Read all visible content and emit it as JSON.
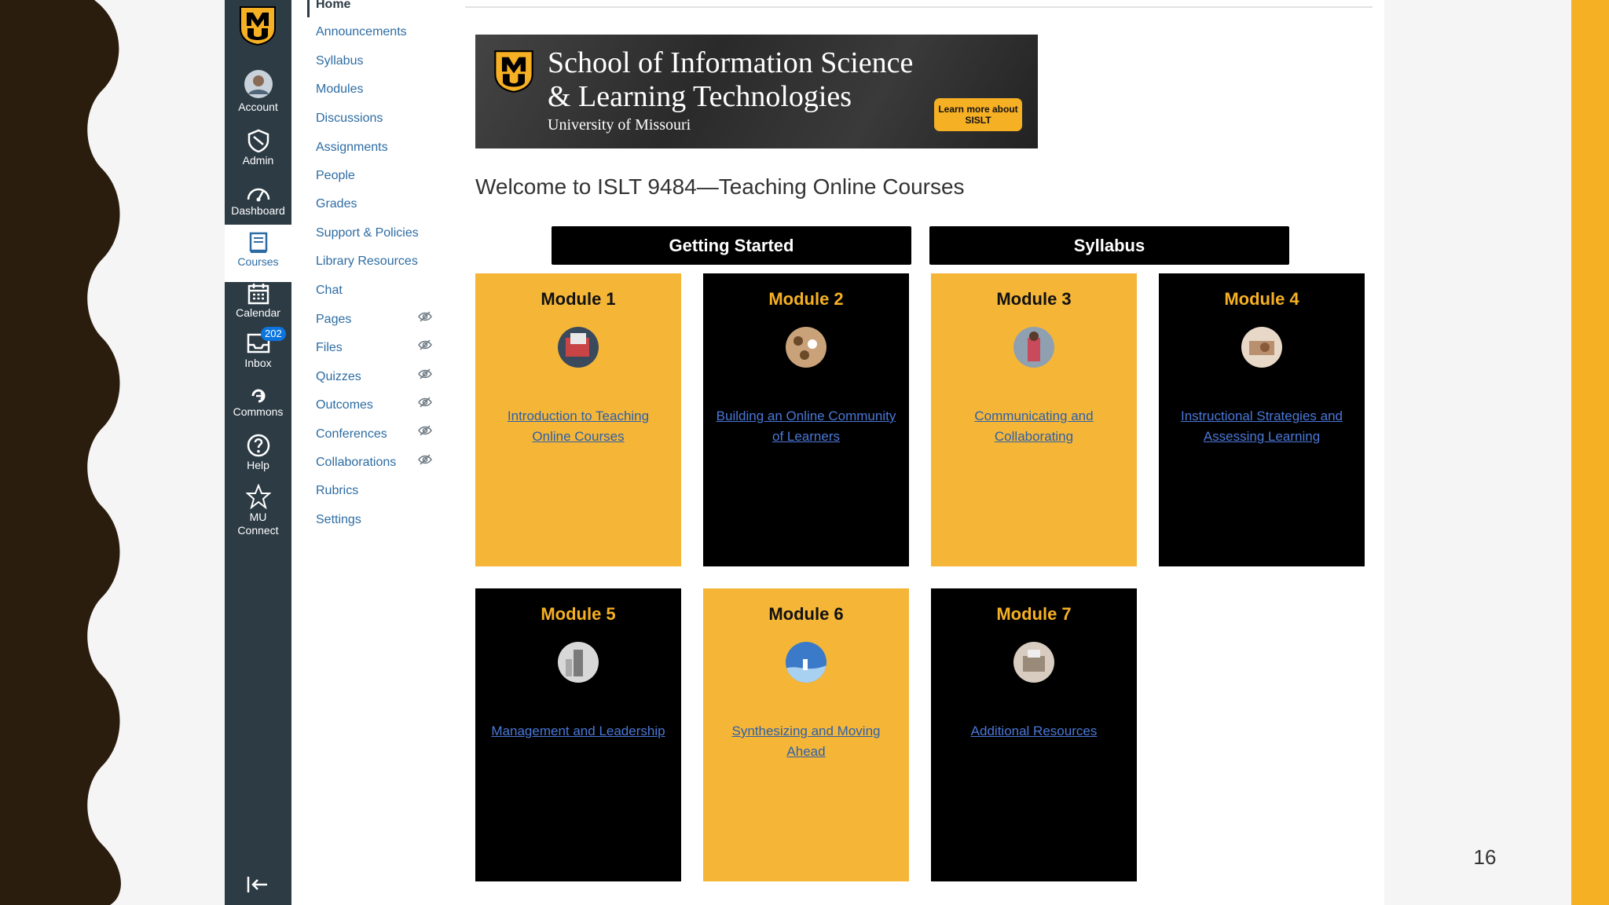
{
  "slide": {
    "page_number": "16"
  },
  "global_nav": {
    "items": [
      {
        "label": "Account",
        "icon": "avatar-icon"
      },
      {
        "label": "Admin",
        "icon": "shield-icon"
      },
      {
        "label": "Dashboard",
        "icon": "dashboard-icon"
      },
      {
        "label": "Courses",
        "icon": "courses-icon",
        "active": true
      },
      {
        "label": "Calendar",
        "icon": "calendar-icon"
      },
      {
        "label": "Inbox",
        "icon": "inbox-icon",
        "badge": "202"
      },
      {
        "label": "Commons",
        "icon": "commons-icon"
      },
      {
        "label": "Help",
        "icon": "help-icon"
      },
      {
        "label": "MU",
        "label2": "Connect",
        "icon": "star-icon"
      }
    ]
  },
  "course_nav": {
    "items": [
      {
        "label": "Home"
      },
      {
        "label": "Announcements"
      },
      {
        "label": "Syllabus"
      },
      {
        "label": "Modules"
      },
      {
        "label": "Discussions"
      },
      {
        "label": "Assignments"
      },
      {
        "label": "People"
      },
      {
        "label": "Grades"
      },
      {
        "label": "Support & Policies"
      },
      {
        "label": "Library Resources"
      },
      {
        "label": "Chat"
      },
      {
        "label": "Pages",
        "hidden": true
      },
      {
        "label": "Files",
        "hidden": true
      },
      {
        "label": "Quizzes",
        "hidden": true
      },
      {
        "label": "Outcomes",
        "hidden": true
      },
      {
        "label": "Conferences",
        "hidden": true
      },
      {
        "label": "Collaborations",
        "hidden": true
      },
      {
        "label": "Rubrics"
      },
      {
        "label": "Settings"
      }
    ]
  },
  "banner": {
    "title_line1": "School of Information Science",
    "title_line2": "& Learning Technologies",
    "subtitle": "University of Missouri",
    "button": "Learn more about SISLT"
  },
  "welcome": "Welcome to ISLT 9484—Teaching Online Courses",
  "buttons": {
    "getting_started": "Getting Started",
    "syllabus": "Syllabus"
  },
  "modules": [
    {
      "title": "Module 1",
      "link": "Introduction to Teaching Online Courses",
      "theme": "gold"
    },
    {
      "title": "Module 2",
      "link": "Building an Online Community of Learners",
      "theme": "black"
    },
    {
      "title": "Module 3",
      "link": "Communicating and Collaborating",
      "theme": "gold"
    },
    {
      "title": "Module 4",
      "link": "Instructional Strategies and Assessing Learning",
      "theme": "black"
    },
    {
      "title": "Module 5",
      "link": "Management and Leadership",
      "theme": "black"
    },
    {
      "title": "Module 6",
      "link": "Synthesizing and Moving Ahead",
      "theme": "gold"
    },
    {
      "title": "Module 7",
      "link": "Additional Resources",
      "theme": "black"
    }
  ],
  "colors": {
    "gold": "#f5b638",
    "black": "#000000",
    "nav_dark": "#2d3b45",
    "link_blue": "#2d6ca3",
    "slide_dark": "#2b1d0e",
    "slide_gold": "#f6b024"
  }
}
